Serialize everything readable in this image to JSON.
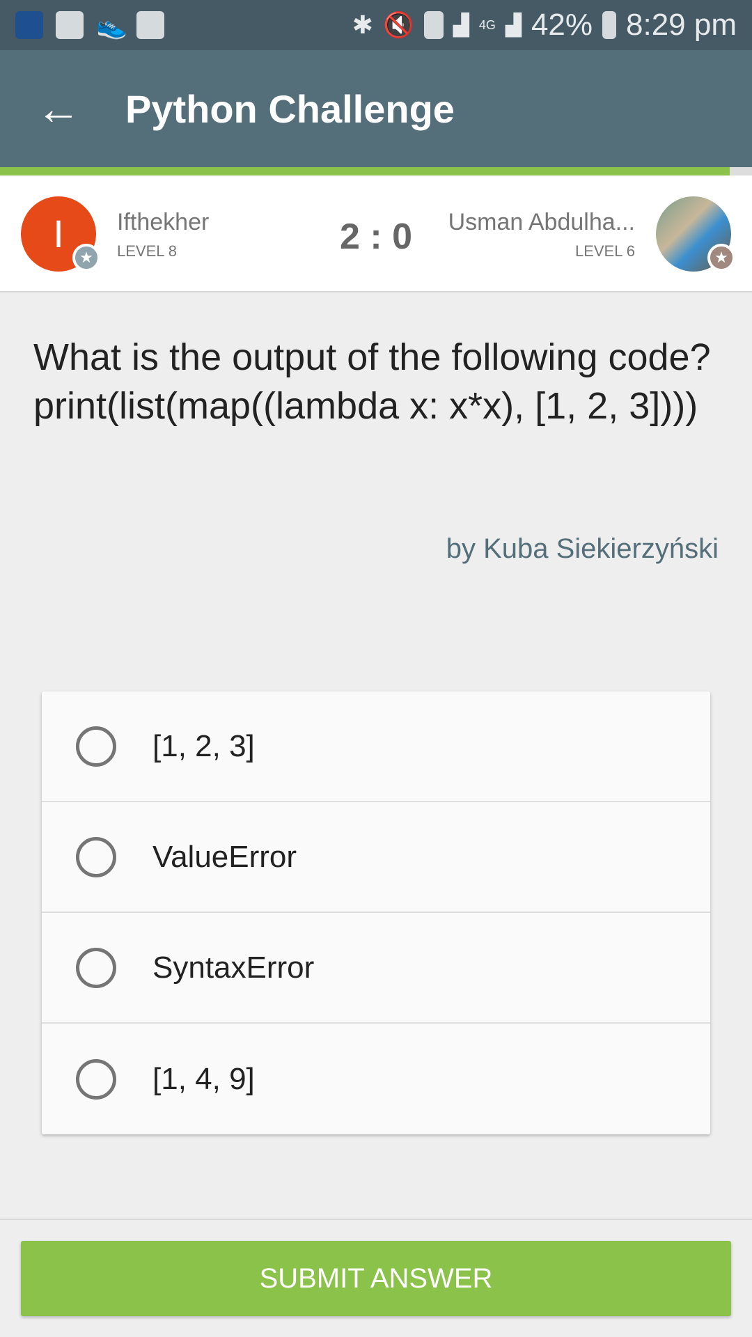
{
  "status_bar": {
    "battery": "42%",
    "time": "8:29 pm",
    "icons": [
      "dictionary-app-icon",
      "youtube-icon",
      "shoe-icon",
      "image-icon",
      "bluetooth-icon",
      "mute-icon",
      "sim-icon",
      "signal-icon",
      "4g-icon",
      "signal-icon"
    ]
  },
  "app_bar": {
    "title": "Python Challenge",
    "back_icon": "arrow-left-icon"
  },
  "progress": {
    "percent": 97,
    "color": "#8bc34a"
  },
  "players": {
    "left": {
      "initial": "I",
      "name": "Ifthekher",
      "level": "LEVEL 8",
      "color": "#e64a19"
    },
    "score": "2 : 0",
    "right": {
      "name": "Usman Abdulha...",
      "level": "LEVEL 6"
    }
  },
  "question": {
    "lines": [
      "What is the output of the following code?",
      "print(list(map((lambda x: x*x), [1, 2, 3])))"
    ],
    "author": "by Kuba Siekierzyński"
  },
  "options": [
    "[1, 2, 3]",
    "ValueError",
    "SyntaxError",
    "[1, 4, 9]"
  ],
  "submit_label": "SUBMIT ANSWER"
}
